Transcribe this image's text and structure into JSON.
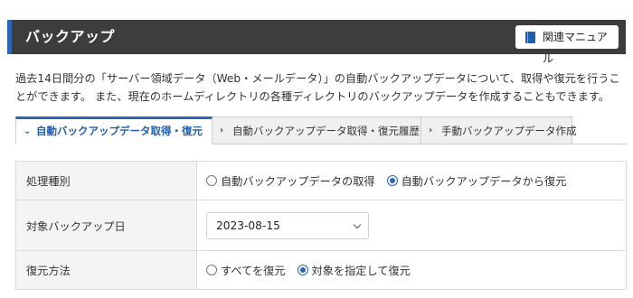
{
  "header": {
    "title": "バックアップ",
    "manual_button": "関連マニュアル"
  },
  "description": "過去14日間分の「サーバー領域データ（Web・メールデータ）」の自動バックアップデータについて、取得や復元を行うことができます。 また、現在のホームディレクトリの各種ディレクトリのバックアップデータを作成することもできます。",
  "tabs": [
    {
      "label": "自動バックアップデータ取得・復元",
      "active": true
    },
    {
      "label": "自動バックアップデータ取得・復元履歴",
      "active": false
    },
    {
      "label": "手動バックアップデータ作成",
      "active": false
    }
  ],
  "form": {
    "process_type": {
      "label": "処理種別",
      "options": [
        "自動バックアップデータの取得",
        "自動バックアップデータから復元"
      ],
      "selected": 1
    },
    "backup_date": {
      "label": "対象バックアップ日",
      "value": "2023-08-15"
    },
    "restore_method": {
      "label": "復元方法",
      "options": [
        "すべてを復元",
        "対象を指定して復元"
      ],
      "selected": 1
    }
  },
  "colors": {
    "header_bg": "#3d3d3d",
    "accent": "#2b66b8"
  }
}
